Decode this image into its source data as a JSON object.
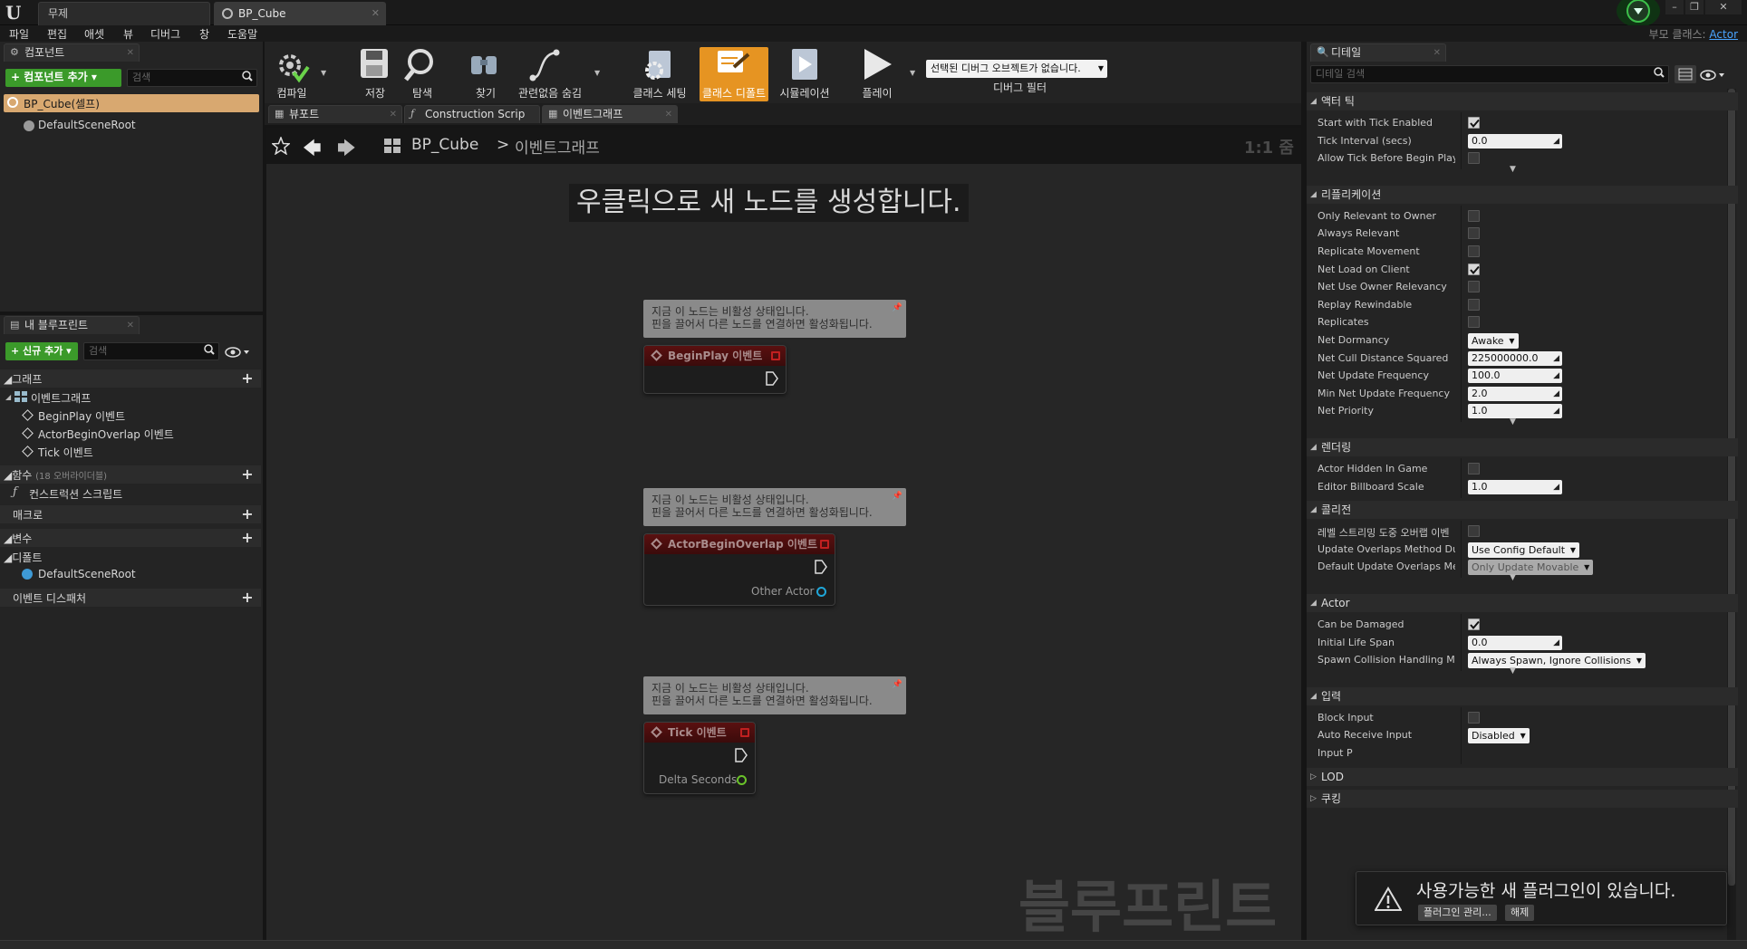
{
  "titlebar": {
    "tabs": [
      {
        "label": "무제"
      },
      {
        "label": "BP_Cube"
      }
    ]
  },
  "menu": {
    "items": [
      "파일",
      "편집",
      "애셋",
      "뷰",
      "디버그",
      "창",
      "도움말"
    ],
    "parent_class_label": "부모 클래스:",
    "parent_class_value": "Actor"
  },
  "components_panel": {
    "tab_label": "컴포넌트",
    "add_button": "+ 컴포넌트 추가 ▾",
    "search_placeholder": "검색",
    "root_item": "BP_Cube(셀프)",
    "child_item": "DefaultSceneRoot"
  },
  "my_blueprint": {
    "tab_label": "내 블루프린트",
    "add_button": "+ 신규 추가 ▾",
    "search_placeholder": "검색",
    "sections": {
      "graphs": "그래프",
      "event_graph": "이벤트그래프",
      "events": [
        "BeginPlay 이벤트",
        "ActorBeginOverlap 이벤트",
        "Tick 이벤트"
      ],
      "functions": "함수",
      "functions_count": "(18 오버라이더블)",
      "construction_script": "컨스트럭션 스크립트",
      "macros": "매크로",
      "variables": "변수",
      "default_category": "디폴트",
      "default_scene_root": "DefaultSceneRoot",
      "event_dispatchers": "이벤트 디스패처"
    }
  },
  "toolbar": {
    "buttons": [
      {
        "label": "컴파일",
        "icon": "compile-icon"
      },
      {
        "label": "저장",
        "icon": "save-icon"
      },
      {
        "label": "탐색",
        "icon": "browse-icon"
      },
      {
        "label": "찾기",
        "icon": "find-icon"
      },
      {
        "label": "관련없음 숨김",
        "icon": "hide-unrelated-icon"
      },
      {
        "label": "클래스 세팅",
        "icon": "class-settings-icon"
      },
      {
        "label": "클래스 디폴트",
        "icon": "class-defaults-icon"
      },
      {
        "label": "시뮬레이션",
        "icon": "simulation-icon"
      },
      {
        "label": "플레이",
        "icon": "play-icon"
      }
    ],
    "debug_select": "선택된 디버그 오브젝트가 없습니다.",
    "debug_filter_label": "디버그 필터"
  },
  "editor_tabs": [
    {
      "label": "뷰포트"
    },
    {
      "label": "Construction Scrip"
    },
    {
      "label": "이벤트그래프"
    }
  ],
  "graph": {
    "breadcrumb_root": "BP_Cube",
    "breadcrumb_sep": ">",
    "breadcrumb_current": "이벤트그래프",
    "zoom": "1:1 줌",
    "hint": "우클릭으로 새 노드를 생성합니다.",
    "watermark": "블루프린트",
    "comment_line1": "지금 이 노드는 비활성 상태입니다.",
    "comment_line2": "핀을 끌어서 다른 노드를 연결하면 활성화됩니다.",
    "nodes": [
      {
        "title": "BeginPlay 이벤트",
        "pin": ""
      },
      {
        "title": "ActorBeginOverlap 이벤트",
        "pin": "Other Actor"
      },
      {
        "title": "Tick 이벤트",
        "pin": "Delta Seconds"
      }
    ]
  },
  "details": {
    "tab_label": "디테일",
    "search_placeholder": "디테일 검색",
    "sections": {
      "tick": "액터 틱",
      "replication": "리플리케이션",
      "rendering": "렌더링",
      "collision": "콜리전",
      "actor": "Actor",
      "input": "입력",
      "lod": "LOD",
      "cooking": "쿠킹"
    },
    "tick_rows": [
      {
        "label": "Start with Tick Enabled",
        "type": "check",
        "checked": true
      },
      {
        "label": "Tick Interval (secs)",
        "type": "num",
        "value": "0.0"
      },
      {
        "label": "Allow Tick Before Begin Play",
        "type": "check",
        "checked": false
      }
    ],
    "replication_rows": [
      {
        "label": "Only Relevant to Owner",
        "type": "check",
        "checked": false
      },
      {
        "label": "Always Relevant",
        "type": "check",
        "checked": false
      },
      {
        "label": "Replicate Movement",
        "type": "check",
        "checked": false
      },
      {
        "label": "Net Load on Client",
        "type": "check",
        "checked": true
      },
      {
        "label": "Net Use Owner Relevancy",
        "type": "check",
        "checked": false
      },
      {
        "label": "Replay Rewindable",
        "type": "check",
        "checked": false
      },
      {
        "label": "Replicates",
        "type": "check",
        "checked": false
      },
      {
        "label": "Net Dormancy",
        "type": "combo",
        "value": "Awake"
      },
      {
        "label": "Net Cull Distance Squared",
        "type": "num",
        "value": "225000000.0"
      },
      {
        "label": "Net Update Frequency",
        "type": "num",
        "value": "100.0"
      },
      {
        "label": "Min Net Update Frequency",
        "type": "num",
        "value": "2.0"
      },
      {
        "label": "Net Priority",
        "type": "num",
        "value": "1.0"
      }
    ],
    "rendering_rows": [
      {
        "label": "Actor Hidden In Game",
        "type": "check",
        "checked": false
      },
      {
        "label": "Editor Billboard Scale",
        "type": "num",
        "value": "1.0"
      }
    ],
    "collision_rows": [
      {
        "label": "레벨 스트리밍 도중 오버랩 이벤",
        "type": "check",
        "checked": false
      },
      {
        "label": "Update Overlaps Method Dur",
        "type": "combo",
        "value": "Use Config Default"
      },
      {
        "label": "Default Update Overlaps Met",
        "type": "combo",
        "value": "Only Update Movable",
        "disabled": true
      }
    ],
    "actor_rows": [
      {
        "label": "Can be Damaged",
        "type": "check",
        "checked": true
      },
      {
        "label": "Initial Life Span",
        "type": "num",
        "value": "0.0"
      },
      {
        "label": "Spawn Collision Handling Me",
        "type": "combo",
        "value": "Always Spawn, Ignore Collisions"
      }
    ],
    "input_rows": [
      {
        "label": "Block Input",
        "type": "check",
        "checked": false
      },
      {
        "label": "Auto Receive Input",
        "type": "combo",
        "value": "Disabled"
      },
      {
        "label": "Input P",
        "type": "none"
      }
    ]
  },
  "notification": {
    "message": "사용가능한 새 플러그인이 있습니다.",
    "manage_button": "플러그인 관리...",
    "dismiss_button": "해제"
  }
}
